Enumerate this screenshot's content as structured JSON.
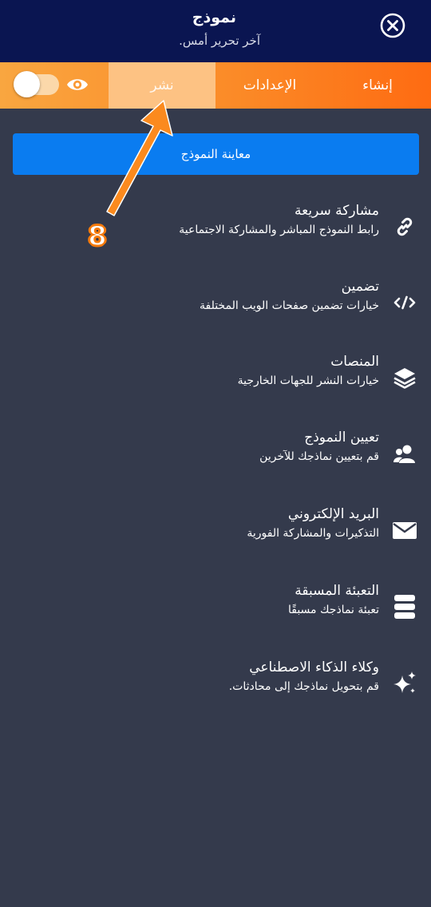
{
  "header": {
    "title": "نموذج",
    "subtitle": "آخر تحرير أمس."
  },
  "tabs": [
    {
      "label": "إنشاء"
    },
    {
      "label": "الإعدادات"
    },
    {
      "label": "نشر"
    }
  ],
  "active_tab": "نشر",
  "toggle": {
    "on": false
  },
  "preview_button": {
    "label": "معاينة النموذج"
  },
  "menu": [
    {
      "title": "مشاركة سريعة",
      "desc": "رابط النموذج المباشر والمشاركة الاجتماعية",
      "icon": "link-icon"
    },
    {
      "title": "تضمين",
      "desc": "خيارات تضمين صفحات الويب المختلفة",
      "icon": "code-icon"
    },
    {
      "title": "المنصات",
      "desc": "خيارات النشر للجهات الخارجية",
      "icon": "layers-icon"
    },
    {
      "title": "تعيين النموذج",
      "desc": "قم بتعيين نماذجك للآخرين",
      "icon": "users-icon"
    },
    {
      "title": "البريد الإلكتروني",
      "desc": "التذكيرات والمشاركة الفورية",
      "icon": "mail-icon"
    },
    {
      "title": "التعبئة المسبقة",
      "desc": "تعبئة نماذجك مسبقًا",
      "icon": "prefill-icon"
    },
    {
      "title": "وكلاء الذكاء الاصطناعي",
      "desc": "قم بتحويل نماذجك إلى محادثات.",
      "icon": "sparkles-icon"
    }
  ],
  "annotation": {
    "number": "8"
  },
  "colors": {
    "header_bg": "#0a1551",
    "page_bg": "#343a4c",
    "accent_orange": "#fe6b12",
    "button_blue": "#0a7cf0"
  }
}
